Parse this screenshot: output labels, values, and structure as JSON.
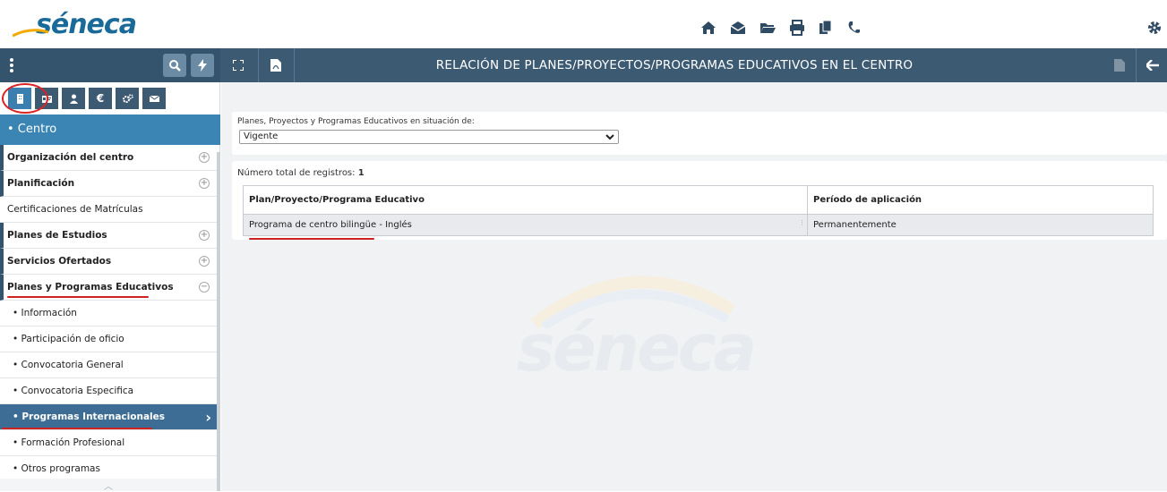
{
  "app": {
    "logo_text": "séneca",
    "watermark_text": "séneca"
  },
  "topbar": {
    "icons": [
      "home-icon",
      "mail-icon",
      "folder-icon",
      "print-icon",
      "copy-icon",
      "phone-icon",
      "settings-icon"
    ]
  },
  "header": {
    "title": "RELACIÓN DE PLANES/PROYECTOS/PROGRAMAS EDUCATIVOS EN EL CENTRO"
  },
  "sidebar": {
    "tabs": [
      "building-icon",
      "id-card-icon",
      "person-icon",
      "euro-icon",
      "gears-icon",
      "envelope-icon"
    ],
    "section_title": "• Centro",
    "items": [
      {
        "label": "Organización del centro"
      },
      {
        "label": "Planificación"
      },
      {
        "label": "Certificaciones de Matrículas"
      },
      {
        "label": "Planes de Estudios"
      },
      {
        "label": "Servicios Ofertados"
      },
      {
        "label": "Planes y Programas Educativos"
      },
      {
        "label": "• Información"
      },
      {
        "label": "• Participación de oficio"
      },
      {
        "label": "• Convocatoria General"
      },
      {
        "label": "• Convocatoria Especifica"
      },
      {
        "label": "• Programas Internacionales"
      },
      {
        "label": "• Formación Profesional"
      },
      {
        "label": "• Otros programas"
      }
    ]
  },
  "filter": {
    "label": "Planes, Proyectos y Programas Educativos en situación de:",
    "selected": "Vigente"
  },
  "results": {
    "count_label": "Número total de registros:",
    "count_value": "1",
    "columns": [
      "Plan/Proyecto/Programa Educativo",
      "Período de aplicación"
    ],
    "rows": [
      {
        "plan": "Programa de centro bilingüe - Inglés",
        "periodo": "Permanentemente"
      }
    ]
  }
}
